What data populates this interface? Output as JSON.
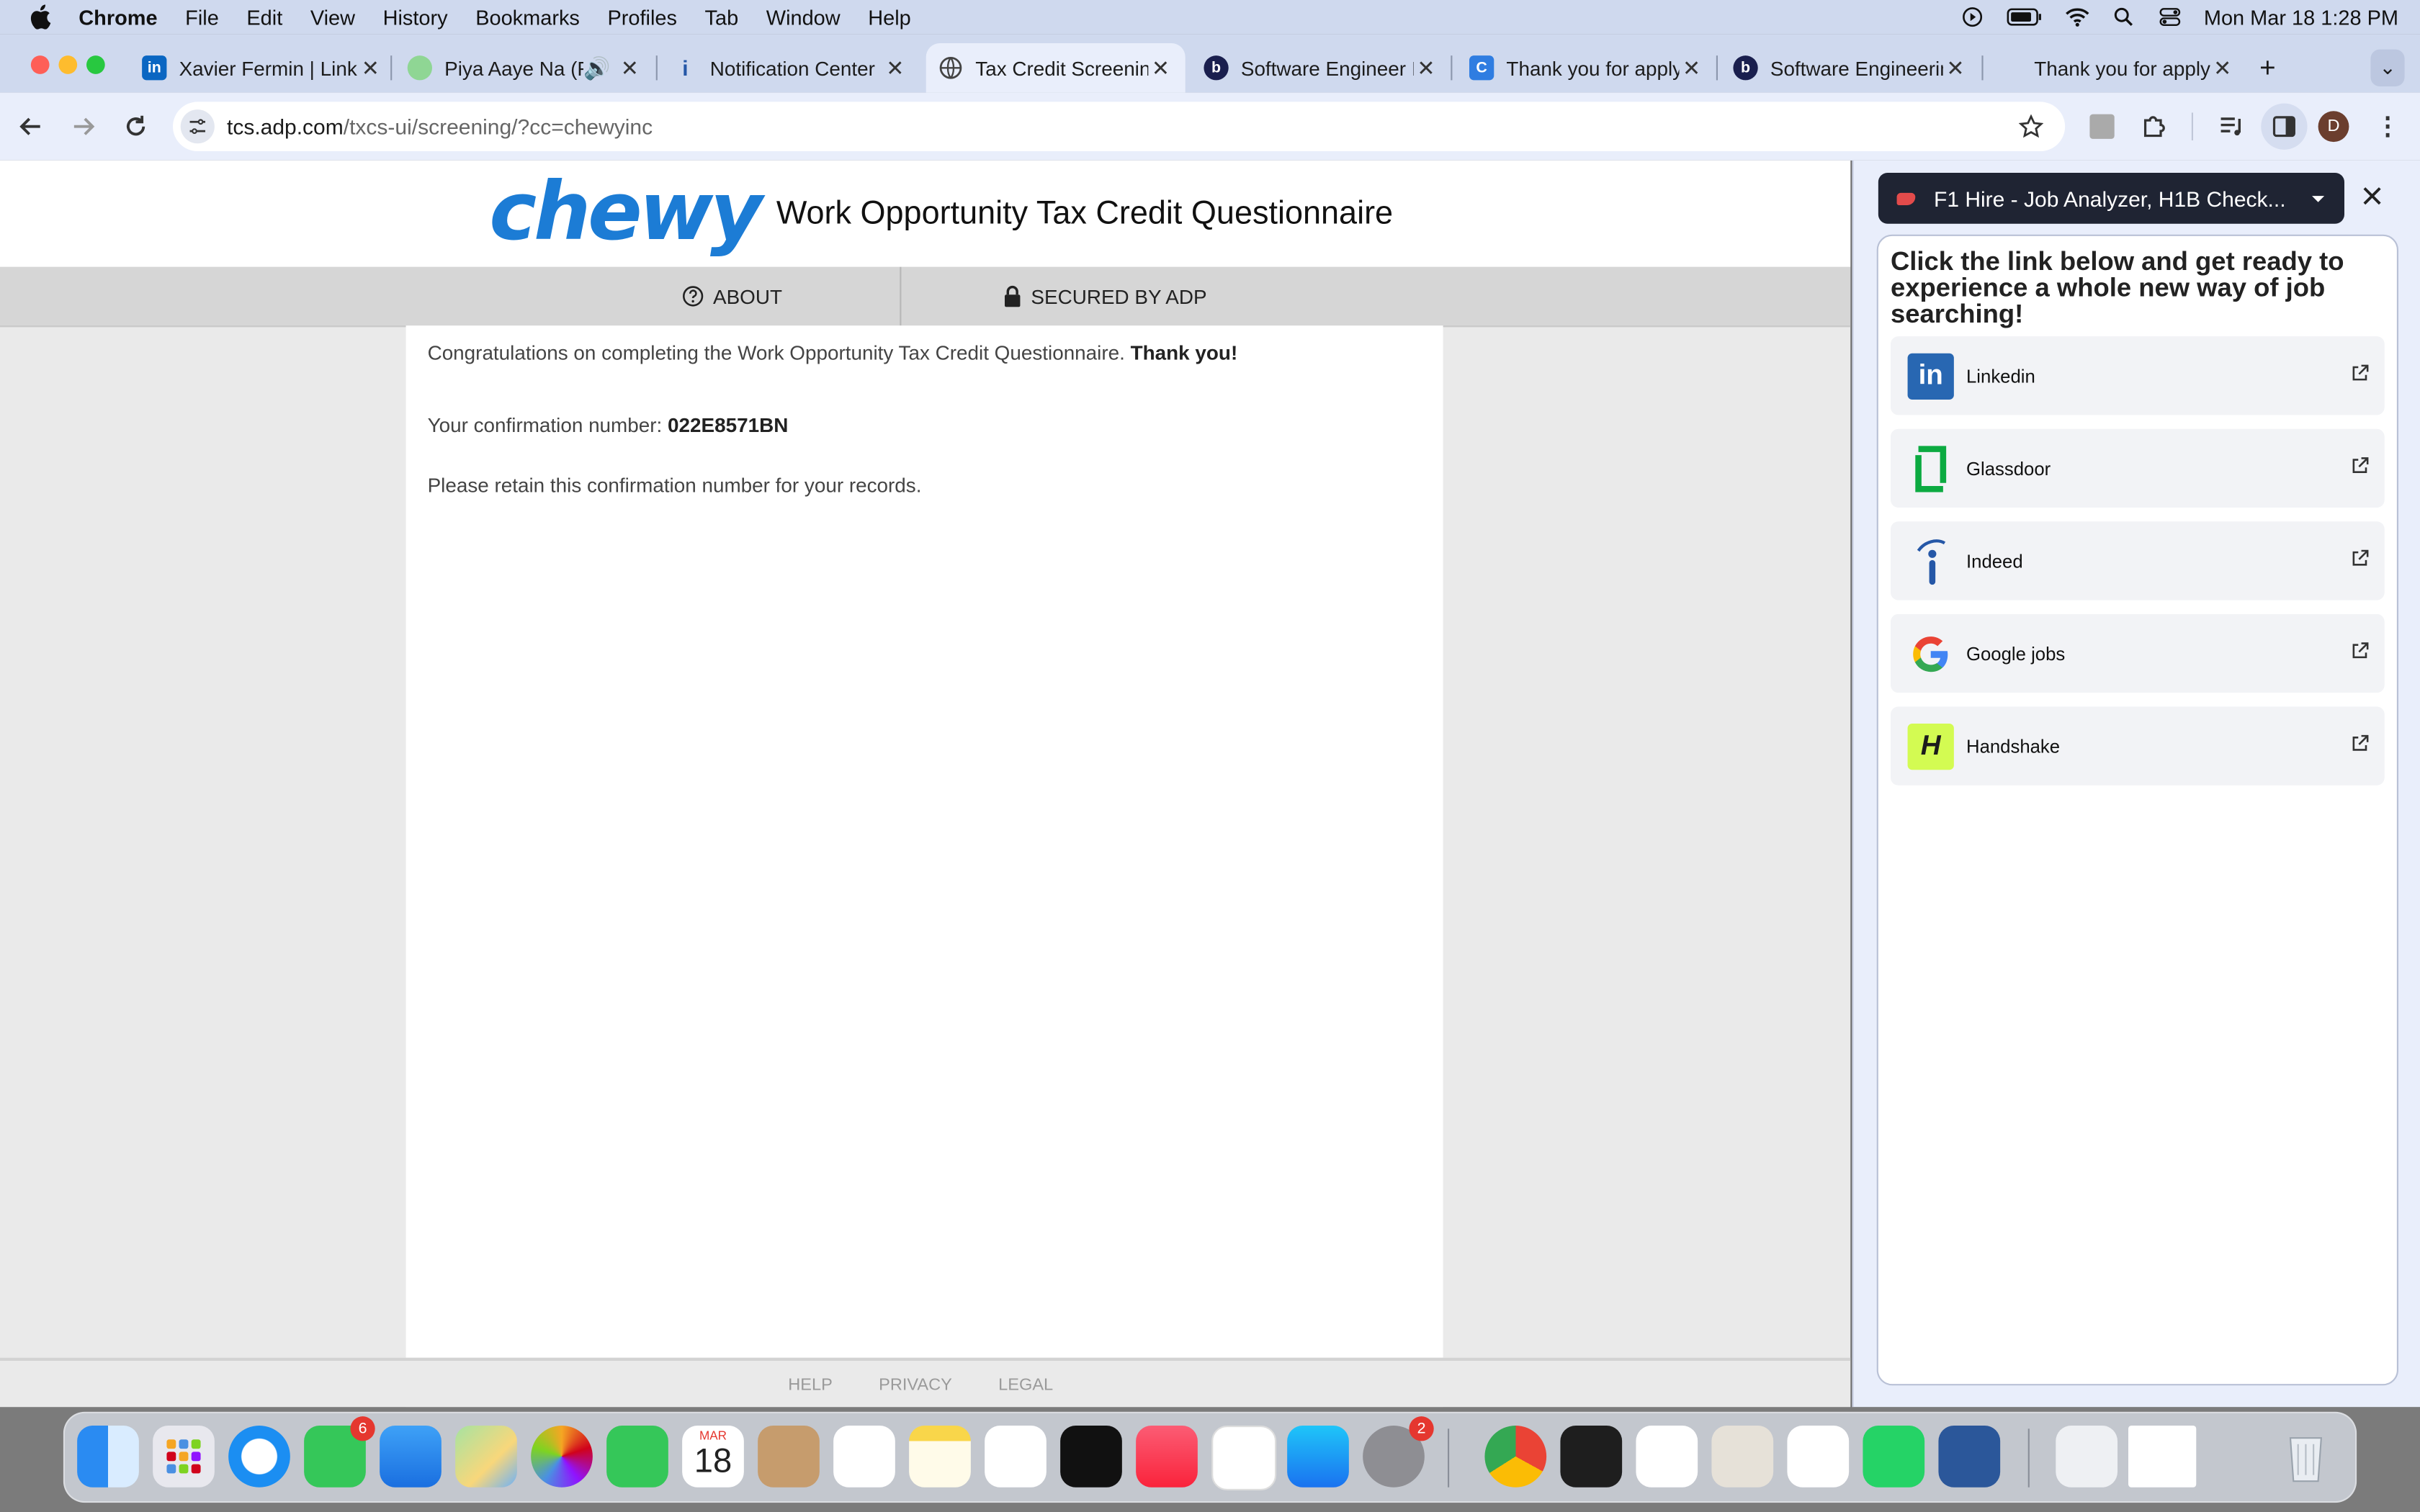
{
  "menubar": {
    "app_name": "Chrome",
    "items": [
      "File",
      "Edit",
      "View",
      "History",
      "Bookmarks",
      "Profiles",
      "Tab",
      "Window",
      "Help"
    ],
    "datetime": "Mon Mar 18  1:28 PM"
  },
  "tabs": [
    {
      "title": "Xavier Fermin | Link",
      "icon": "linkedin-icon"
    },
    {
      "title": "Piya Aaye Na (Fr",
      "icon": "music-icon"
    },
    {
      "title": "Notification Center",
      "icon": "indeed-icon"
    },
    {
      "title": "Tax Credit Screening",
      "icon": "globe-icon",
      "active": true
    },
    {
      "title": "Software Engineer I",
      "icon": "b-icon"
    },
    {
      "title": "Thank you for apply",
      "icon": "c-icon"
    },
    {
      "title": "Software Engineerin",
      "icon": "b-icon"
    },
    {
      "title": "Thank you for apply",
      "icon": "none"
    }
  ],
  "address_bar": {
    "host": "tcs.adp.com",
    "path": "/txcs-ui/screening/?cc=chewyinc"
  },
  "profile_initial": "D",
  "page": {
    "logo_text": "chewy",
    "title": "Work Opportunity Tax Credit Questionnaire",
    "nav": {
      "about": "ABOUT",
      "secured": "SECURED BY ADP"
    },
    "congrats_text": "Congratulations on completing the Work Opportunity Tax Credit Questionnaire.",
    "thank_you": "Thank you!",
    "confirmation_label": "Your confirmation number:",
    "confirmation_number": "022E8571BN",
    "retain_text": "Please retain this confirmation number for your records.",
    "footer": [
      "HELP",
      "PRIVACY",
      "LEGAL"
    ]
  },
  "sidepanel": {
    "extension_name": "F1 Hire - Job Analyzer, H1B Check...",
    "heading": "Click the link below and get ready to experience a whole new way of job searching!",
    "links": [
      {
        "label": "Linkedin",
        "icon": "linkedin-icon",
        "color": "#2867b2"
      },
      {
        "label": "Glassdoor",
        "icon": "glassdoor-icon",
        "color": "#0caa41"
      },
      {
        "label": "Indeed",
        "icon": "indeed-icon",
        "color": "#2557a7"
      },
      {
        "label": "Google jobs",
        "icon": "google-icon",
        "color": "#4285f4"
      },
      {
        "label": "Handshake",
        "icon": "handshake-icon",
        "color": "#d3fb52"
      }
    ]
  },
  "dock": {
    "messages_badge": "6",
    "settings_badge": "2",
    "calendar_month": "MAR",
    "calendar_day": "18"
  },
  "colors": {
    "chewy_blue": "#1c7cd5",
    "chrome_frame": "#cfd9ee",
    "toolbar": "#e9eefb"
  }
}
